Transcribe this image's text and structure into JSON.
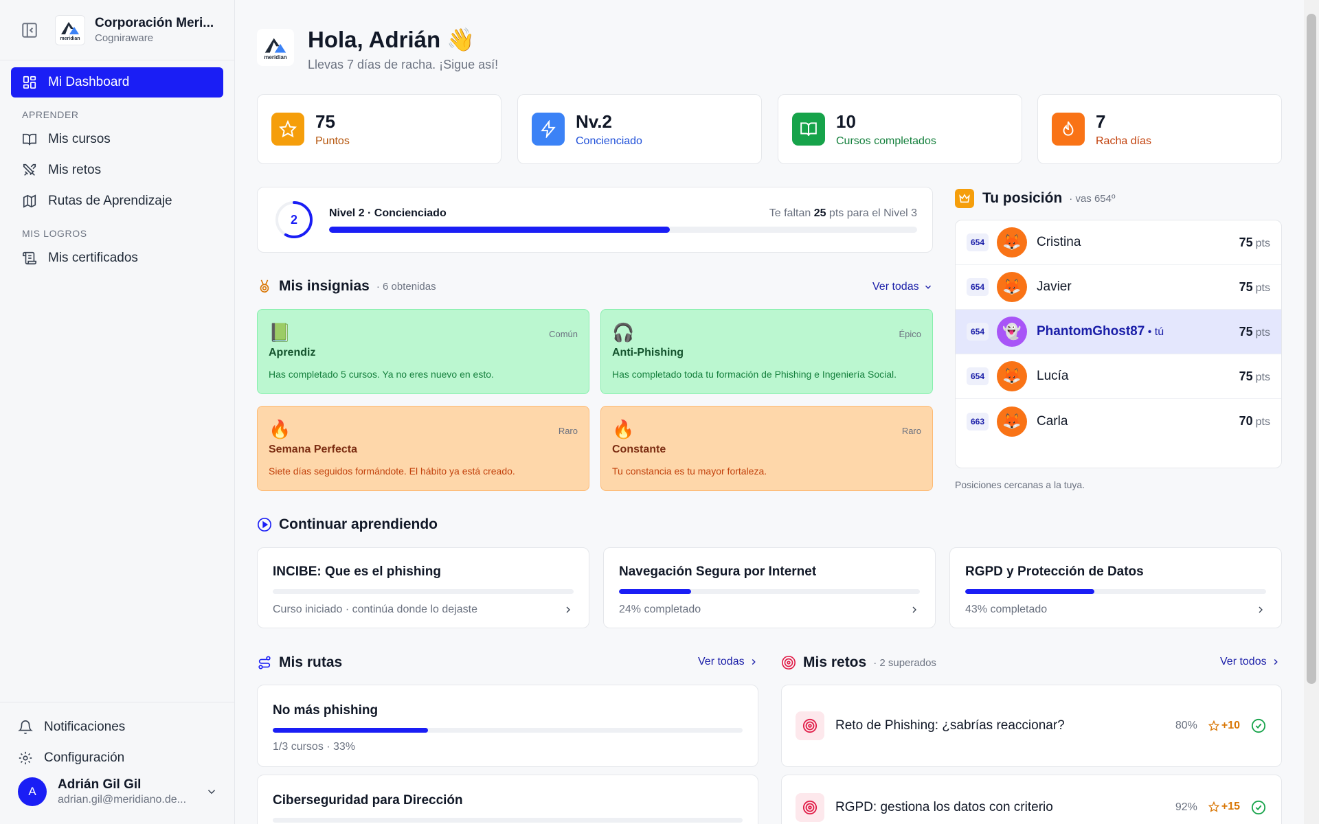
{
  "org": {
    "name": "Corporación Meri...",
    "sub": "Cogniraware",
    "logo_text": "meridian"
  },
  "nav": {
    "dashboard": "Mi Dashboard",
    "section_learn": "APRENDER",
    "courses": "Mis cursos",
    "challenges": "Mis retos",
    "paths": "Rutas de Aprendizaje",
    "section_achievements": "MIS LOGROS",
    "certificates": "Mis certificados",
    "notifications": "Notificaciones",
    "settings": "Configuración"
  },
  "user": {
    "initial": "A",
    "name": "Adrián Gil Gil",
    "email": "adrian.gil@meridiano.de..."
  },
  "header": {
    "title": "Hola, Adrián 👋",
    "subtitle": "Llevas 7 días de racha. ¡Sigue así!"
  },
  "stats": [
    {
      "value": "75",
      "label": "Puntos",
      "color": "#f59e0b",
      "label_color": "#b45309"
    },
    {
      "value": "Nv.2",
      "label": "Concienciado",
      "color": "#3b82f6",
      "label_color": "#1d4ed8"
    },
    {
      "value": "10",
      "label": "Cursos completados",
      "color": "#16a34a",
      "label_color": "#15803d"
    },
    {
      "value": "7",
      "label": "Racha días",
      "color": "#f97316",
      "label_color": "#c2410c"
    }
  ],
  "level": {
    "number": "2",
    "title": "Nivel 2 · Concienciado",
    "remaining_prefix": "Te faltan ",
    "remaining_pts": "25",
    "remaining_suffix": " pts para el Nivel 3",
    "progress": 0.58
  },
  "badges": {
    "title": "Mis insignias",
    "count": "· 6 obtenidas",
    "see_all": "Ver todas",
    "items": [
      {
        "icon": "📗",
        "rarity": "Común",
        "name": "Aprendiz",
        "desc": "Has completado 5 cursos. Ya no eres nuevo en esto."
      },
      {
        "icon": "🎧",
        "rarity": "Épico",
        "name": "Anti-Phishing",
        "desc": "Has completado toda tu formación de Phishing e Ingeniería Social."
      },
      {
        "icon": "🔥",
        "rarity": "Raro",
        "name": "Semana Perfecta",
        "desc": "Siete días seguidos formándote. El hábito ya está creado."
      },
      {
        "icon": "🔥",
        "rarity": "Raro",
        "name": "Constante",
        "desc": "Tu constancia es tu mayor fortaleza."
      }
    ]
  },
  "ranking": {
    "title": "Tu posición",
    "sub": "· vas 654º",
    "footer": "Posiciones cercanas a la tuya.",
    "unit": "pts",
    "rows": [
      {
        "pos": "654",
        "avatar": "🦊",
        "name": "Cristina",
        "pts": "75"
      },
      {
        "pos": "654",
        "avatar": "🦊",
        "name": "Javier",
        "pts": "75"
      },
      {
        "pos": "654",
        "avatar": "👻",
        "name": "PhantomGhost87",
        "you": " • tú",
        "pts": "75"
      },
      {
        "pos": "654",
        "avatar": "🦊",
        "name": "Lucía",
        "pts": "75"
      },
      {
        "pos": "663",
        "avatar": "🦊",
        "name": "Carla",
        "pts": "70"
      }
    ]
  },
  "continue": {
    "title": "Continuar aprendiendo",
    "items": [
      {
        "name": "INCIBE: Que es el phishing",
        "status": "Curso iniciado · continúa donde lo dejaste",
        "progress": 0
      },
      {
        "name": "Navegación Segura por Internet",
        "status": "24% completado",
        "progress": 0.24
      },
      {
        "name": "RGPD y Protección de Datos",
        "status": "43% completado",
        "progress": 0.43
      }
    ]
  },
  "routes": {
    "title": "Mis rutas",
    "see_all": "Ver todas",
    "items": [
      {
        "name": "No más phishing",
        "status": "1/3 cursos · 33%",
        "progress": 0.33
      },
      {
        "name": "Ciberseguridad para Dirección",
        "status": "",
        "progress": 0
      }
    ]
  },
  "challenges": {
    "title": "Mis retos",
    "count": "· 2 superados",
    "see_all": "Ver todos",
    "items": [
      {
        "name": "Reto de Phishing: ¿sabrías reaccionar?",
        "pct": "80%",
        "pts": "+10"
      },
      {
        "name": "RGPD: gestiona los datos con criterio",
        "pct": "92%",
        "pts": "+15"
      }
    ]
  }
}
